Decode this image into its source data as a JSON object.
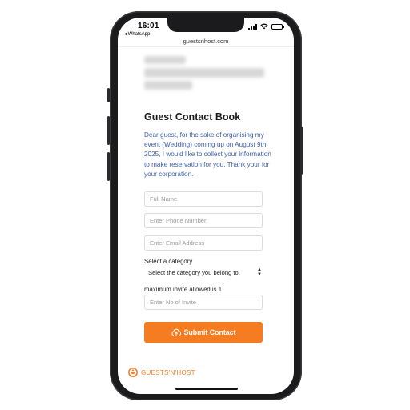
{
  "status_bar": {
    "time": "16:01",
    "back_app": "◂ WhatsApp"
  },
  "browser": {
    "url": "guestsnhost.com"
  },
  "form": {
    "title": "Guest Contact Book",
    "intro": "Dear guest, for the sake of organising my event (Wedding) coming up on August 9th 2025, I would like to collect your information to make reservation for you. Thank your for your corporation.",
    "full_name_placeholder": "Full Name",
    "full_name_value": "",
    "phone_placeholder": "Enter Phone Number",
    "phone_value": "",
    "email_placeholder": "Enter Email Address",
    "email_value": "",
    "category_label": "Select a category",
    "category_selected": "Select the category you belong to.",
    "invite_label": "maximum invite allowed is 1",
    "invite_placeholder": "Enter No of Invite",
    "invite_value": "",
    "submit_label": "Submit Contact"
  },
  "footer": {
    "brand_text": "GUESTS'N'HOST"
  },
  "colors": {
    "accent": "#f57c21",
    "intro_text": "#3d5fa8",
    "phone_frame": "#1b1b1d"
  }
}
